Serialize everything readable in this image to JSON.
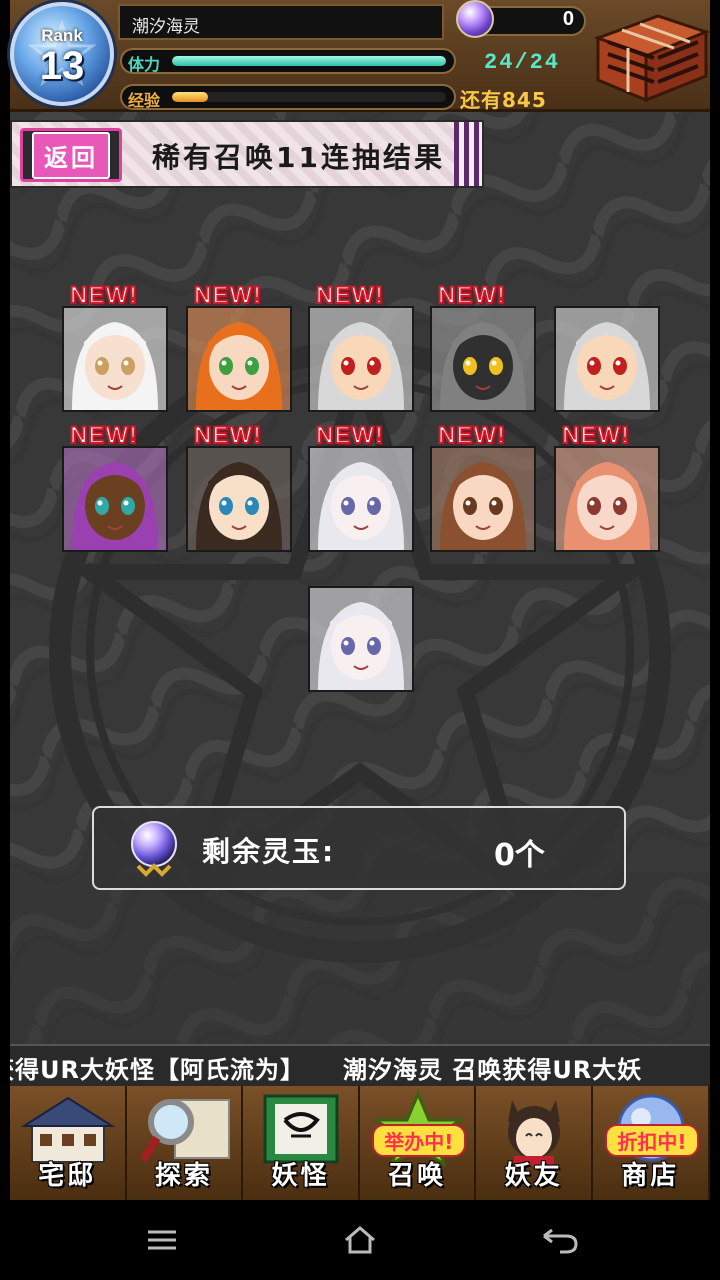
{
  "header": {
    "rank_label": "Rank",
    "rank_value": "13",
    "player_name": "潮汐海灵",
    "stamina_label": "体力",
    "stamina_fraction": 1.0,
    "stamina_value": "24/24",
    "exp_label": "经验",
    "exp_fraction": 0.13,
    "remaining_exp": "还有845",
    "gem_count": "0",
    "colors": {
      "stamina": "#30c0a8",
      "exp": "#e89018",
      "rank_badge": "#2c5ea8"
    },
    "icons": {
      "gem": "spirit-jade-icon",
      "chest": "treasure-chest-icon",
      "rank": "pentagram-badge-icon"
    }
  },
  "title_bar": {
    "back_label": "返回",
    "title": "稀有召唤11连抽结果"
  },
  "results": {
    "new_label": "NEW!",
    "cards": [
      {
        "name": "white-hood-girl",
        "is_new": true
      },
      {
        "name": "orange-hair-girl",
        "is_new": true
      },
      {
        "name": "shouting-kid-1",
        "is_new": true
      },
      {
        "name": "grey-hair-yellow-eyes",
        "is_new": true
      },
      {
        "name": "shouting-kid-2",
        "is_new": false
      },
      {
        "name": "purple-crown-girl",
        "is_new": true
      },
      {
        "name": "dark-hair-girl",
        "is_new": true
      },
      {
        "name": "white-hair-girl-1",
        "is_new": true
      },
      {
        "name": "brown-hair-girl",
        "is_new": true
      },
      {
        "name": "pink-hair-girl",
        "is_new": true
      },
      {
        "name": "white-hair-girl-2",
        "is_new": false
      }
    ]
  },
  "gem_panel": {
    "label": "剩余灵玉:",
    "value": "0个",
    "icon": "spirit-jade-icon"
  },
  "ticker": {
    "text": "获得UR大妖怪【阿氏流为】　　潮汐海灵 召唤获得UR大妖"
  },
  "nav": {
    "items": [
      {
        "label": "宅邸",
        "icon": "mansion-icon",
        "badge": ""
      },
      {
        "label": "探索",
        "icon": "magnifier-map-icon",
        "badge": ""
      },
      {
        "label": "妖怪",
        "icon": "scroll-icon",
        "badge": ""
      },
      {
        "label": "召唤",
        "icon": "summon-star-icon",
        "badge": "举办中!"
      },
      {
        "label": "妖友",
        "icon": "catgirl-icon",
        "badge": ""
      },
      {
        "label": "商店",
        "icon": "crystal-orb-icon",
        "badge": "折扣中!"
      }
    ]
  },
  "system_bar": {
    "icons": [
      "menu-icon",
      "home-icon",
      "back-arrow-icon"
    ]
  }
}
